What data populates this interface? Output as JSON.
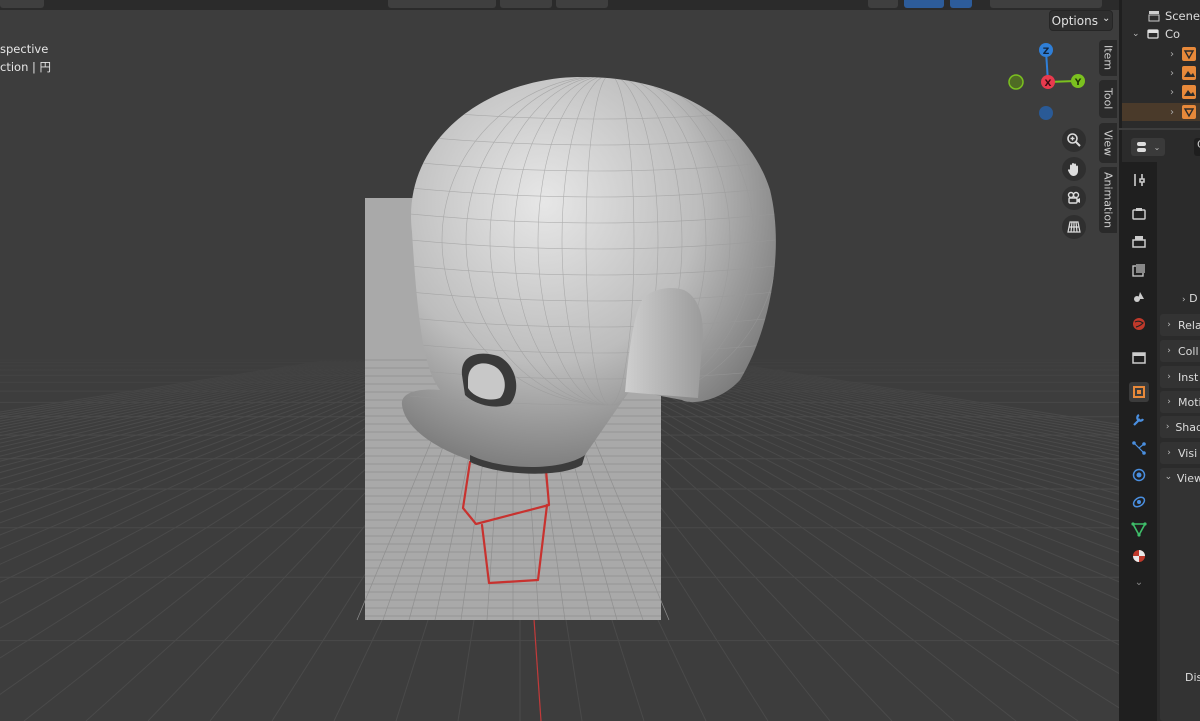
{
  "viewport": {
    "label_line1": "spective",
    "label_line2": "ction | 円",
    "options_label": "Options",
    "options_chevron": "⌄",
    "gizmo_axes": {
      "z": "Z",
      "x": "X",
      "y": "Y"
    },
    "n_tabs": [
      "Item",
      "Tool",
      "View",
      "Animation"
    ],
    "nav_buttons": [
      "zoom-icon",
      "hand-pan-icon",
      "camera-icon",
      "grid-ortho-icon"
    ]
  },
  "outliner": {
    "rows": [
      {
        "label": "Scene",
        "icon": "scene-icon"
      },
      {
        "label": "Co",
        "icon": "collection-icon"
      },
      {
        "label": "",
        "icon": "mesh-triangle-icon"
      },
      {
        "label": "",
        "icon": "image-empty-icon"
      },
      {
        "label": "",
        "icon": "image-empty-icon"
      },
      {
        "label": "",
        "icon": "mesh-triangle-icon"
      }
    ]
  },
  "properties": {
    "header_label": "C",
    "side_labels": [
      "S",
      "D"
    ],
    "panels": [
      "Rela",
      "Coll",
      "Inst",
      "Moti",
      "Shad",
      "Visi",
      "View"
    ],
    "bottom_label": "Disp",
    "tabs": [
      "tool-icon",
      "render-icon",
      "output-icon",
      "view-layer-icon",
      "scene-icon",
      "world-icon",
      "collection-icon",
      "object-icon",
      "modifier-icon",
      "particles-icon",
      "physics-icon",
      "constraints-icon",
      "data-icon",
      "material-icon",
      "more-icon"
    ]
  },
  "colors": {
    "accent_orange": "#e8893a",
    "axis_x": "#e83a4e",
    "axis_y": "#7bc11f",
    "axis_z": "#2f7fd8"
  }
}
